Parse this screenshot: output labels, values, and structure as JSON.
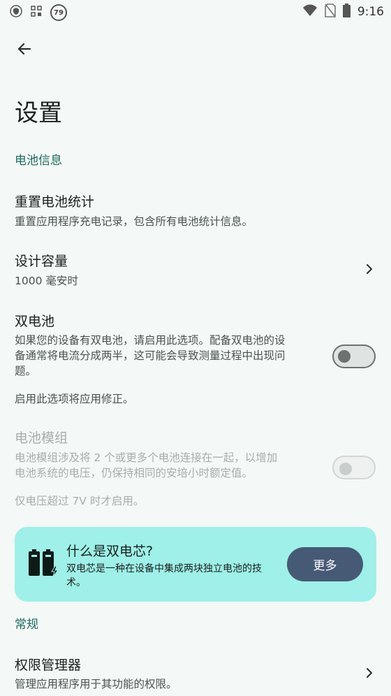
{
  "status_bar": {
    "time": "9:16",
    "badge": "79"
  },
  "page": {
    "title": "设置"
  },
  "sections": {
    "battery_info": "电池信息",
    "general": "常规"
  },
  "items": {
    "reset_stats": {
      "title": "重置电池统计",
      "subtitle": "重置应用程序充电记录，包含所有电池统计信息。"
    },
    "design_capacity": {
      "title": "设计容量",
      "subtitle": "1000 毫安时"
    },
    "dual_battery": {
      "title": "双电池",
      "subtitle_line1": "如果您的设备有双电池，请启用此选项。配备双电池的设",
      "subtitle_line2": "备通常将电流分成两半，这可能会导致测量过程中出现问",
      "subtitle_line3": "题。",
      "note": "启用此选项将应用修正。",
      "enabled": false
    },
    "battery_pack": {
      "title": "电池模组",
      "subtitle_line1": "电池模组涉及将 2 个或更多个电池连接在一起，以增加",
      "subtitle_line2": "电池系统的电压，仍保持相同的安培小时额定值。",
      "note": "仅电压超过 7V 时才启用。",
      "enabled": false
    },
    "permissions": {
      "title": "权限管理器",
      "subtitle": "管理应用程序用于其功能的权限。"
    }
  },
  "info_card": {
    "title": "什么是双电芯?",
    "text_line1": "双电芯是一种在设备中集成两块独立电池的技",
    "text_line2": "术。",
    "button": "更多",
    "color": "#9ef0e8",
    "button_color": "#475a75"
  },
  "colors": {
    "accent": "#1a6b5f",
    "background": "#f4f8f6"
  }
}
